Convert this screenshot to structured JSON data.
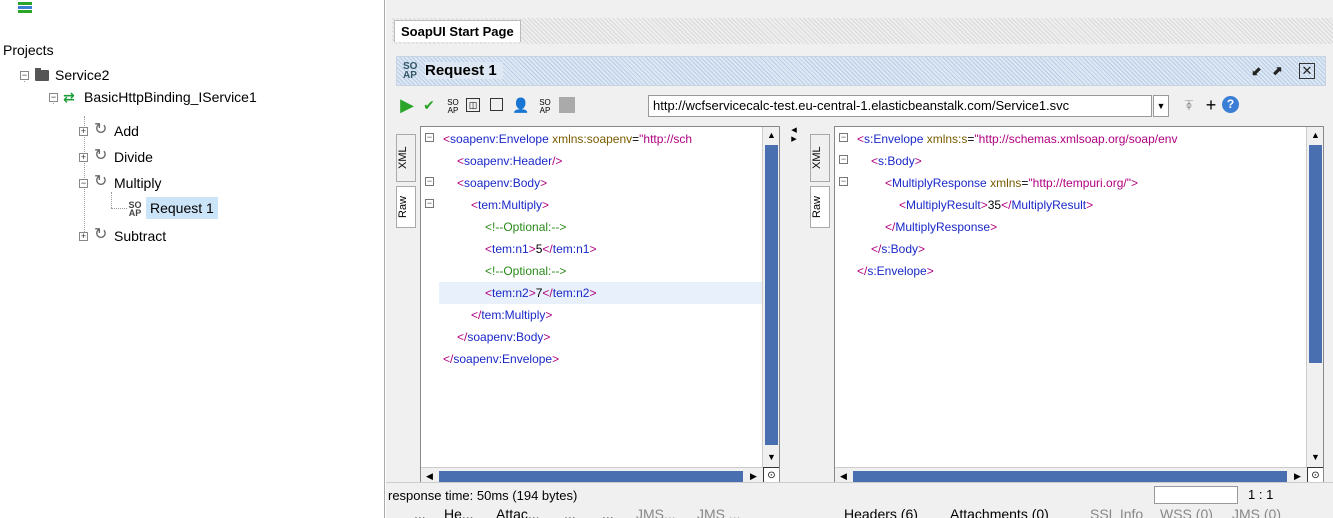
{
  "navigator": {
    "title": "Projects",
    "tree": {
      "project": "Service2",
      "interface": "BasicHttpBinding_IService1",
      "operations": [
        "Add",
        "Divide",
        "Multiply",
        "Subtract"
      ],
      "request": "Request 1",
      "request_icon": "SO\nAP"
    }
  },
  "tabs": {
    "start_page": "SoapUI Start Page"
  },
  "request": {
    "title": "Request 1",
    "soap_badge": "SO AP",
    "endpoint": "http://wcfservicecalc-test.eu-central-1.elasticbeanstalk.com/Service1.svc"
  },
  "editors": {
    "request_side_tabs": [
      "XML",
      "Raw"
    ],
    "response_side_tabs": [
      "XML",
      "Raw"
    ],
    "request_xml": [
      {
        "indent": 0,
        "parts": [
          [
            "t",
            "<"
          ],
          [
            "tn",
            "soapenv:Envelope"
          ],
          [
            "at",
            " xmlns:soapenv"
          ],
          [
            "tx",
            "="
          ],
          [
            "av",
            "\"http://sch"
          ]
        ]
      },
      {
        "indent": 1,
        "parts": [
          [
            "t",
            "<"
          ],
          [
            "tn",
            "soapenv:Header"
          ],
          [
            "t",
            "/>"
          ]
        ]
      },
      {
        "indent": 1,
        "parts": [
          [
            "t",
            "<"
          ],
          [
            "tn",
            "soapenv:Body"
          ],
          [
            "t",
            ">"
          ]
        ]
      },
      {
        "indent": 2,
        "parts": [
          [
            "t",
            "<"
          ],
          [
            "tn",
            "tem:Multiply"
          ],
          [
            "t",
            ">"
          ]
        ]
      },
      {
        "indent": 3,
        "parts": [
          [
            "cm",
            "<!--Optional:-->"
          ]
        ]
      },
      {
        "indent": 3,
        "parts": [
          [
            "t",
            "<"
          ],
          [
            "tn",
            "tem:n1"
          ],
          [
            "t",
            ">"
          ],
          [
            "tx",
            "5"
          ],
          [
            "t",
            "</"
          ],
          [
            "tn",
            "tem:n1"
          ],
          [
            "t",
            ">"
          ]
        ]
      },
      {
        "indent": 3,
        "parts": [
          [
            "cm",
            "<!--Optional:-->"
          ]
        ]
      },
      {
        "indent": 3,
        "parts": [
          [
            "t",
            "<"
          ],
          [
            "tn",
            "tem:n2"
          ],
          [
            "t",
            ">"
          ],
          [
            "tx",
            "7"
          ],
          [
            "t",
            "</"
          ],
          [
            "tn",
            "tem:n2"
          ],
          [
            "t",
            ">"
          ]
        ],
        "highlight": true
      },
      {
        "indent": 2,
        "parts": [
          [
            "t",
            "</"
          ],
          [
            "tn",
            "tem:Multiply"
          ],
          [
            "t",
            ">"
          ]
        ]
      },
      {
        "indent": 1,
        "parts": [
          [
            "t",
            "</"
          ],
          [
            "tn",
            "soapenv:Body"
          ],
          [
            "t",
            ">"
          ]
        ]
      },
      {
        "indent": 0,
        "parts": [
          [
            "t",
            "</"
          ],
          [
            "tn",
            "soapenv:Envelope"
          ],
          [
            "t",
            ">"
          ]
        ]
      }
    ],
    "response_xml": [
      {
        "indent": 0,
        "parts": [
          [
            "t",
            "<"
          ],
          [
            "tn",
            "s:Envelope"
          ],
          [
            "at",
            " xmlns:s"
          ],
          [
            "tx",
            "="
          ],
          [
            "av",
            "\"http://schemas.xmlsoap.org/soap/env"
          ]
        ]
      },
      {
        "indent": 1,
        "parts": [
          [
            "t",
            "<"
          ],
          [
            "tn",
            "s:Body"
          ],
          [
            "t",
            ">"
          ]
        ]
      },
      {
        "indent": 2,
        "parts": [
          [
            "t",
            "<"
          ],
          [
            "tn",
            "MultiplyResponse"
          ],
          [
            "at",
            " xmlns"
          ],
          [
            "tx",
            "="
          ],
          [
            "av",
            "\"http://tempuri.org/\""
          ],
          [
            "t",
            ">"
          ]
        ]
      },
      {
        "indent": 3,
        "parts": [
          [
            "t",
            "<"
          ],
          [
            "tn",
            "MultiplyResult"
          ],
          [
            "t",
            ">"
          ],
          [
            "tx",
            "35"
          ],
          [
            "t",
            "</"
          ],
          [
            "tn",
            "MultiplyResult"
          ],
          [
            "t",
            ">"
          ]
        ]
      },
      {
        "indent": 2,
        "parts": [
          [
            "t",
            "</"
          ],
          [
            "tn",
            "MultiplyResponse"
          ],
          [
            "t",
            ">"
          ]
        ]
      },
      {
        "indent": 1,
        "parts": [
          [
            "t",
            "</"
          ],
          [
            "tn",
            "s:Body"
          ],
          [
            "t",
            ">"
          ]
        ]
      },
      {
        "indent": 0,
        "parts": [
          [
            "t",
            "</"
          ],
          [
            "tn",
            "s:Envelope"
          ],
          [
            "t",
            ">"
          ]
        ]
      }
    ]
  },
  "request_bottom_tabs": {
    "t1": "...",
    "t2": "He...",
    "t3": "Attac...",
    "t4": "...",
    "t5": "...",
    "t6": "JMS...",
    "t7": "JMS ..."
  },
  "response_bottom_tabs": {
    "headers": "Headers (6)",
    "attachments": "Attachments (0)",
    "ssl": "SSL Info",
    "wss": "WSS (0)",
    "jms": "JMS (0)"
  },
  "status": {
    "text": "response time: 50ms (194 bytes)",
    "position": "1 : 1"
  },
  "colors": {
    "selection": "#cce4f7",
    "scroll_thumb": "#4a6fb0",
    "run_button": "#2aa52a"
  }
}
